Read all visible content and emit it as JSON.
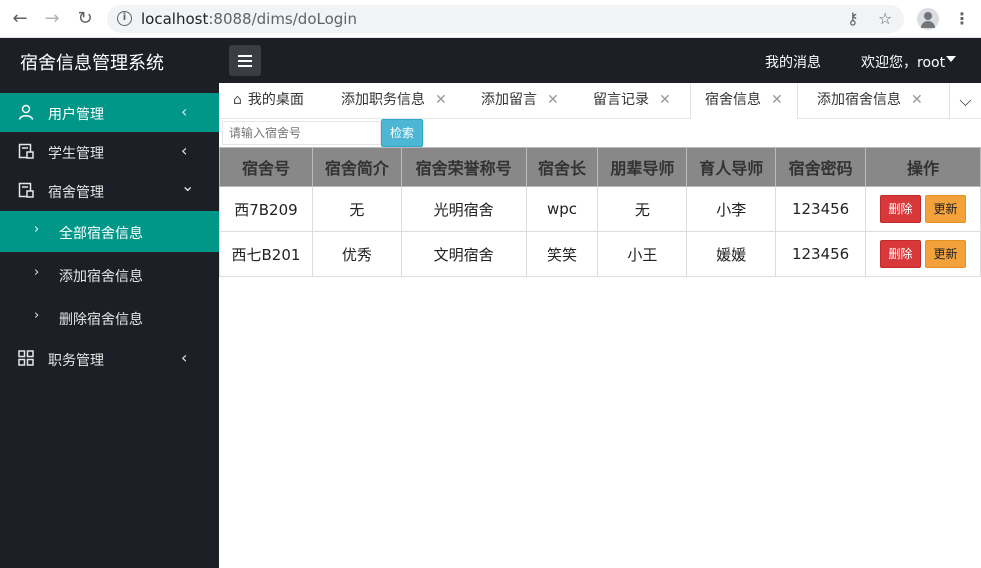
{
  "browser": {
    "url_host": "localhost",
    "url_rest": ":8088/dims/doLogin"
  },
  "header": {
    "app_title": "宿舍信息管理系统",
    "messages": "我的消息",
    "user": "欢迎您，root"
  },
  "sidebar": {
    "items": [
      {
        "label": "用户管理",
        "icon": "user-icon",
        "chevron": "‹"
      },
      {
        "label": "学生管理",
        "icon": "document-icon",
        "chevron": "‹"
      },
      {
        "label": "宿舍管理",
        "icon": "document-icon",
        "chevron": "⌄"
      },
      {
        "label": "职务管理",
        "icon": "grid-icon",
        "chevron": "‹"
      }
    ],
    "subitems": [
      {
        "label": "全部宿舍信息"
      },
      {
        "label": "添加宿舍信息"
      },
      {
        "label": "删除宿舍信息"
      }
    ]
  },
  "tabs": [
    {
      "label": "我的桌面"
    },
    {
      "label": "添加职务信息"
    },
    {
      "label": "添加留言"
    },
    {
      "label": "留言记录"
    },
    {
      "label": "宿舍信息"
    },
    {
      "label": "添加宿舍信息"
    }
  ],
  "search": {
    "placeholder": "请输入宿舍号",
    "button": "检索"
  },
  "table": {
    "headers": [
      "宿舍号",
      "宿舍简介",
      "宿舍荣誉称号",
      "宿舍长",
      "朋辈导师",
      "育人导师",
      "宿舍密码",
      "操作"
    ],
    "rows": [
      [
        "西7B209",
        "无",
        "光明宿舍",
        "wpc",
        "无",
        "小李",
        "123456"
      ],
      [
        "西七B201",
        "优秀",
        "文明宿舍",
        "笑笑",
        "小王",
        "媛媛",
        "123456"
      ]
    ],
    "delete_label": "删除",
    "update_label": "更新"
  },
  "colors": {
    "accent": "#009688",
    "sidebar_bg": "#1c1f26",
    "delete": "#d9383a",
    "update": "#f3a23b",
    "search_button": "#4cb6d4"
  }
}
